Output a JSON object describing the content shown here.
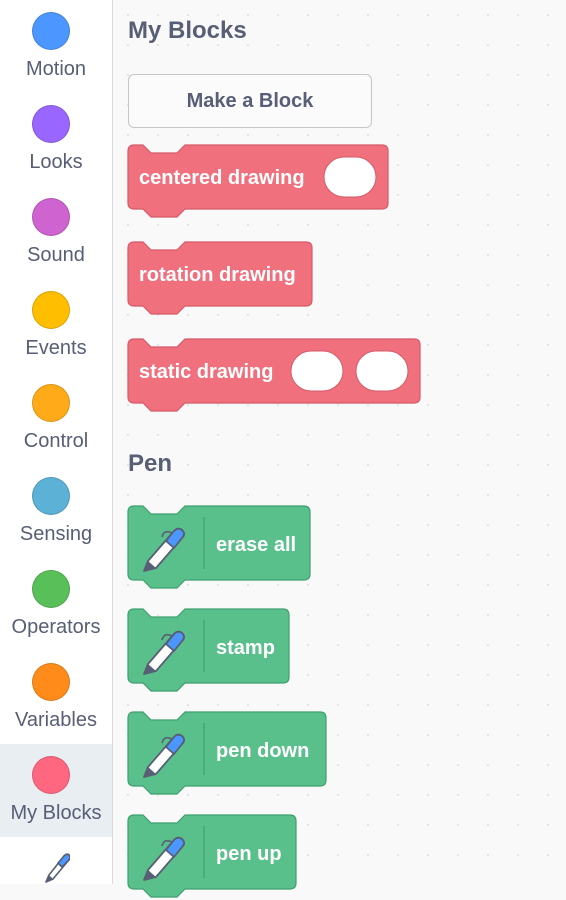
{
  "categories": [
    {
      "label": "Motion",
      "color": "#4c97ff"
    },
    {
      "label": "Looks",
      "color": "#9966ff"
    },
    {
      "label": "Sound",
      "color": "#cf63cf"
    },
    {
      "label": "Events",
      "color": "#ffbf00"
    },
    {
      "label": "Control",
      "color": "#ffab19"
    },
    {
      "label": "Sensing",
      "color": "#5cb1d6"
    },
    {
      "label": "Operators",
      "color": "#59c059"
    },
    {
      "label": "Variables",
      "color": "#ff8c1a"
    },
    {
      "label": "My Blocks",
      "color": "#ff6680"
    }
  ],
  "selected_category": "My Blocks",
  "extension_icon": "pen-icon",
  "my_blocks": {
    "title": "My Blocks",
    "make_block_label": "Make a Block",
    "color": "#f0707e",
    "blocks": [
      {
        "label": "centered drawing",
        "inputs": 1
      },
      {
        "label": "rotation drawing",
        "inputs": 0
      },
      {
        "label": "static drawing",
        "inputs": 2
      }
    ]
  },
  "pen": {
    "title": "Pen",
    "color": "#59c08b",
    "blocks": [
      {
        "label": "erase all",
        "icon": "pen-icon"
      },
      {
        "label": "stamp",
        "icon": "pen-icon"
      },
      {
        "label": "pen down",
        "icon": "pen-icon"
      },
      {
        "label": "pen up",
        "icon": "pen-icon"
      }
    ]
  }
}
